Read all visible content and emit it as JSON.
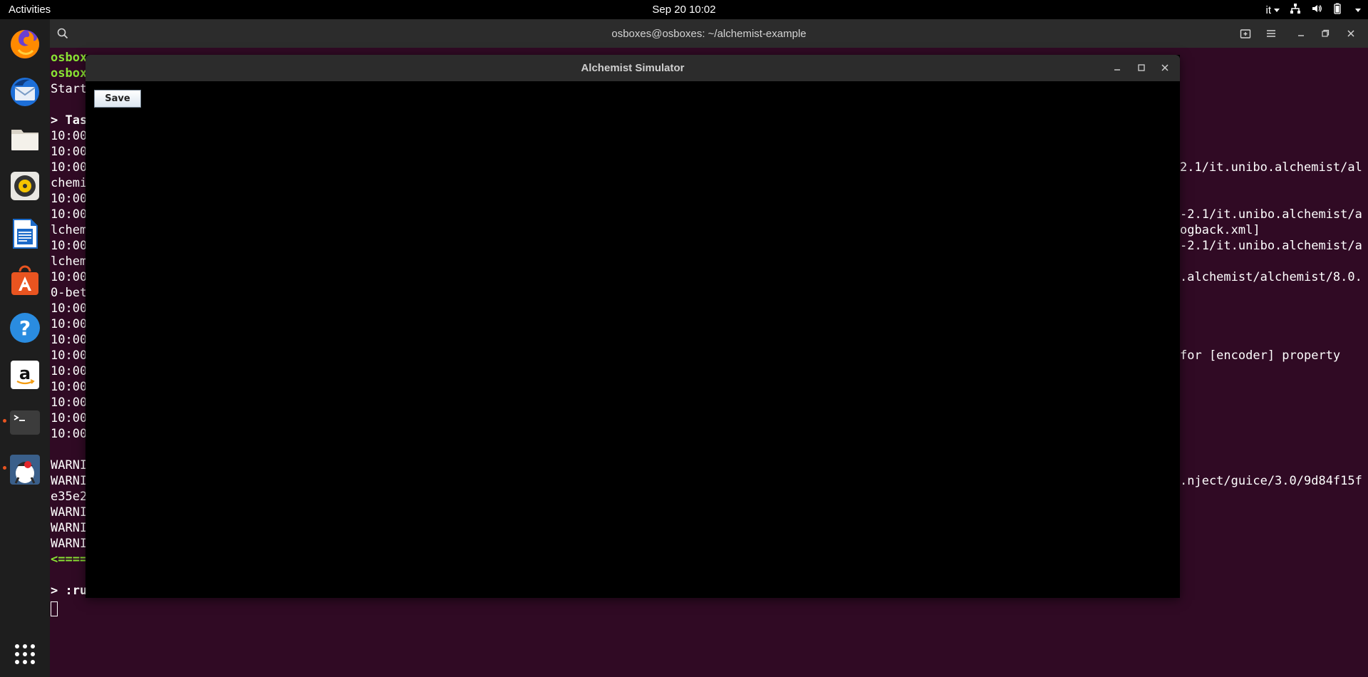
{
  "topbar": {
    "activities": "Activities",
    "clock": "Sep 20  10:02",
    "keyboard_layout": "it"
  },
  "dock": {
    "items": [
      "firefox-icon",
      "thunderbird-icon",
      "files-icon",
      "rhythmbox-icon",
      "libreoffice-writer-icon",
      "software-icon",
      "help-icon",
      "amazon-icon",
      "terminal-icon",
      "java-icon",
      "show-apps-icon"
    ]
  },
  "terminal": {
    "title": "osboxes@osboxes: ~/alchemist-example",
    "left_lines": [
      {
        "text": "osbox",
        "style": "green"
      },
      {
        "text": "osbox",
        "style": "green"
      },
      {
        "text": "Start",
        "style": ""
      },
      {
        "text": "",
        "style": ""
      },
      {
        "text": "> Tas",
        "style": "bold"
      },
      {
        "text": "10:00",
        "style": ""
      },
      {
        "text": "10:00",
        "style": ""
      },
      {
        "text": "10:00",
        "style": ""
      },
      {
        "text": "chemi",
        "style": ""
      },
      {
        "text": "10:00",
        "style": ""
      },
      {
        "text": "10:00",
        "style": ""
      },
      {
        "text": "lchem",
        "style": ""
      },
      {
        "text": "10:00",
        "style": ""
      },
      {
        "text": "lchem",
        "style": ""
      },
      {
        "text": "10:00",
        "style": ""
      },
      {
        "text": "0-bet",
        "style": ""
      },
      {
        "text": "10:00",
        "style": ""
      },
      {
        "text": "10:00",
        "style": ""
      },
      {
        "text": "10:00",
        "style": ""
      },
      {
        "text": "10:00",
        "style": ""
      },
      {
        "text": "10:00",
        "style": ""
      },
      {
        "text": "10:00",
        "style": ""
      },
      {
        "text": "10:00",
        "style": ""
      },
      {
        "text": "10:00",
        "style": ""
      },
      {
        "text": "10:00",
        "style": ""
      },
      {
        "text": "",
        "style": ""
      },
      {
        "text": "WARNI",
        "style": ""
      },
      {
        "text": "WARNI",
        "style": ""
      },
      {
        "text": "e35e2",
        "style": ""
      },
      {
        "text": "WARNI",
        "style": ""
      },
      {
        "text": "WARNI",
        "style": ""
      },
      {
        "text": "WARNI",
        "style": ""
      },
      {
        "text": "<====",
        "style": "green"
      },
      {
        "text": "",
        "style": ""
      },
      {
        "text": "> :ru",
        "style": "bold"
      }
    ],
    "right_lines": [
      {
        "row": 7,
        "text": "2.1/it.unibo.alchemist/al"
      },
      {
        "row": 10,
        "text": "-2.1/it.unibo.alchemist/a"
      },
      {
        "row": 11,
        "text": "ogback.xml]"
      },
      {
        "row": 12,
        "text": "-2.1/it.unibo.alchemist/a"
      },
      {
        "row": 14,
        "text": ".alchemist/alchemist/8.0."
      },
      {
        "row": 19,
        "text": "for [encoder] property"
      },
      {
        "row": 27,
        "text": ".nject/guice/3.0/9d84f15f"
      }
    ]
  },
  "alchemist": {
    "title": "Alchemist Simulator",
    "save_label": "Save"
  }
}
